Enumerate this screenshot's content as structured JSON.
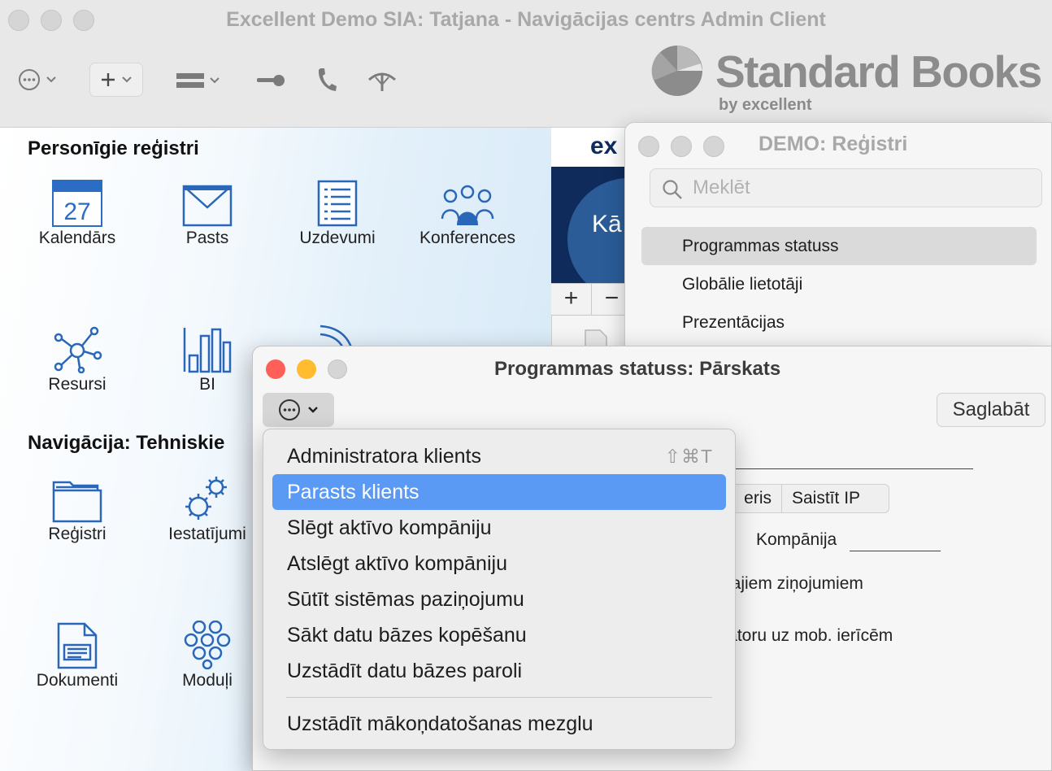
{
  "main_window": {
    "title": "Excellent Demo SIA: Tatjana - Navigācijas centrs Admin Client",
    "brand": {
      "name": "Standard Books",
      "sub": "by excellent"
    },
    "toolbar": [
      {
        "icon": "ellipsis-circle-icon"
      },
      {
        "icon": "plus-icon"
      },
      {
        "icon": "list-icon"
      },
      {
        "icon": "key-icon"
      },
      {
        "icon": "phone-icon"
      },
      {
        "icon": "antenna-icon"
      }
    ],
    "section_personal": "Personīgie reģistri",
    "personal_tiles": [
      {
        "label": "Kalendārs",
        "icon": "calendar-icon",
        "calendar_day": "27"
      },
      {
        "label": "Pasts",
        "icon": "mail-icon"
      },
      {
        "label": "Uzdevumi",
        "icon": "tasks-icon"
      },
      {
        "label": "Konferences",
        "icon": "conferences-icon"
      },
      {
        "label": "Resursi",
        "icon": "resources-icon"
      },
      {
        "label": "BI",
        "icon": "bar-chart-icon"
      }
    ],
    "section_nav": "Navigācija: Tehniskie",
    "nav_tiles": [
      {
        "label": "Reģistri",
        "icon": "folder-icon"
      },
      {
        "label": "Iestatījumi",
        "icon": "settings-gears-icon"
      },
      {
        "label": "Dokumenti",
        "icon": "document-icon"
      },
      {
        "label": "Moduļi",
        "icon": "modules-hexagons-icon"
      }
    ],
    "ad_text_top": "ex",
    "ad_text": "Kā",
    "plus_label": "+",
    "minus_label": "−"
  },
  "registers_window": {
    "title": "DEMO: Reģistri",
    "search_placeholder": "Meklēt",
    "items": [
      "Programmas statuss",
      "Globālie lietotāji",
      "Prezentācijas"
    ],
    "selected_index": 0
  },
  "status_window": {
    "title": "Programmas statuss: Pārskats",
    "save_label": "Saglabāt",
    "segment_left": "eris",
    "segment_right": "Saistīt IP",
    "company_label": "Kompānija",
    "text_line1": "ītajiem ziņojumiem",
    "text_line2": "ikatoru uz mob. ierīcēm"
  },
  "action_menu": {
    "items": [
      {
        "label": "Administratora klients",
        "shortcut": "⇧⌘T"
      },
      {
        "label": "Parasts klients",
        "highlighted": true
      },
      {
        "label": "Slēgt aktīvo kompāniju"
      },
      {
        "label": "Atslēgt aktīvo kompāniju"
      },
      {
        "label": "Sūtīt sistēmas paziņojumu"
      },
      {
        "label": "Sākt datu bāzes kopēšanu"
      },
      {
        "label": "Uzstādīt datu bāzes paroli"
      }
    ],
    "footer_item": "Uzstādīt mākoņdatošanas mezglu"
  },
  "colors": {
    "menu_highlight": "#5a9af5",
    "traffic_close": "#fe5f57",
    "traffic_minimize": "#febc2e",
    "calendar_blue": "#2b6cc4",
    "icon_blue": "#2a67b8"
  }
}
